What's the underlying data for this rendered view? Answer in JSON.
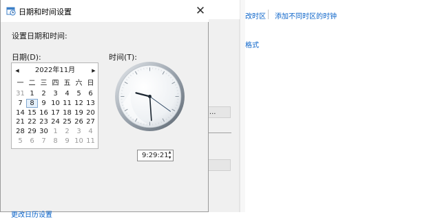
{
  "background": {
    "link_change_timezone": "改时区",
    "link_add_clocks": "添加不同时区的时钟",
    "link_formats": "格式",
    "button_partial": ")...",
    "link_color": "#0a63c9"
  },
  "dialog": {
    "title": "日期和时间设置",
    "title_icon": "clock-calendar-icon",
    "close_label": "✕",
    "set_label": "设置日期和时间:",
    "date_label": "日期(D):",
    "time_label": "时间(T):",
    "bottom_link": "更改日历设置",
    "time_value": "9:29:21",
    "clock": {
      "hours": 9,
      "minutes": 29,
      "seconds": 21
    }
  },
  "calendar": {
    "prev_label": "◀",
    "next_label": "▶",
    "month_title": "2022年11月",
    "weekdays": [
      "一",
      "二",
      "三",
      "四",
      "五",
      "六",
      "日"
    ],
    "weeks": [
      [
        {
          "d": "31",
          "o": true
        },
        {
          "d": "1"
        },
        {
          "d": "2"
        },
        {
          "d": "3"
        },
        {
          "d": "4"
        },
        {
          "d": "5"
        },
        {
          "d": "6"
        }
      ],
      [
        {
          "d": "7"
        },
        {
          "d": "8",
          "sel": true
        },
        {
          "d": "9"
        },
        {
          "d": "10"
        },
        {
          "d": "11"
        },
        {
          "d": "12"
        },
        {
          "d": "13"
        }
      ],
      [
        {
          "d": "14"
        },
        {
          "d": "15"
        },
        {
          "d": "16"
        },
        {
          "d": "17"
        },
        {
          "d": "18"
        },
        {
          "d": "19"
        },
        {
          "d": "20"
        }
      ],
      [
        {
          "d": "21"
        },
        {
          "d": "22"
        },
        {
          "d": "23"
        },
        {
          "d": "24"
        },
        {
          "d": "25"
        },
        {
          "d": "26"
        },
        {
          "d": "27"
        }
      ],
      [
        {
          "d": "28"
        },
        {
          "d": "29"
        },
        {
          "d": "30"
        },
        {
          "d": "1",
          "o": true
        },
        {
          "d": "2",
          "o": true
        },
        {
          "d": "3",
          "o": true
        },
        {
          "d": "4",
          "o": true
        }
      ],
      [
        {
          "d": "5",
          "o": true
        },
        {
          "d": "6",
          "o": true
        },
        {
          "d": "7",
          "o": true
        },
        {
          "d": "8",
          "o": true
        },
        {
          "d": "9",
          "o": true
        },
        {
          "d": "10",
          "o": true
        },
        {
          "d": "11",
          "o": true
        }
      ]
    ]
  }
}
